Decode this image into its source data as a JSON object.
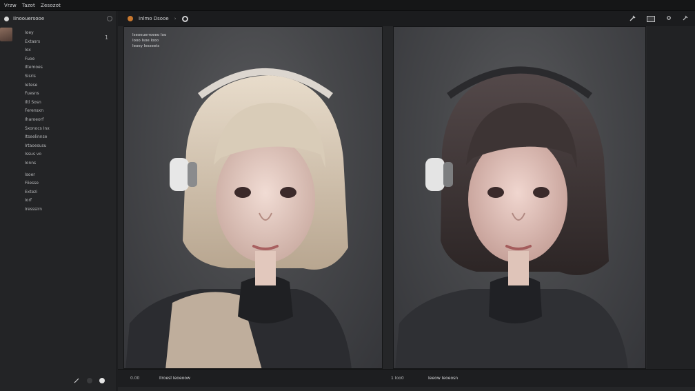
{
  "menubar": {
    "items": [
      "Vrzw",
      "Tazot",
      "Zesozot"
    ]
  },
  "sidebar": {
    "title": "Iinoouersooe",
    "count": "1",
    "items": [
      "Ioey",
      "Extasrs",
      "Iox",
      "Fuoe",
      "Iltemoes",
      "Sisris",
      "Ietese",
      "Fuesns",
      "Iltl Sosn",
      "Ferensxn",
      "Iharoeorf",
      "Sxonocs Inx",
      "Itseelinnse",
      "Irtaoesusu",
      "Issus vo",
      "Ionns",
      "Isoer",
      "Fiiesse",
      "Extezi",
      "Iorf",
      "Iresssirn"
    ]
  },
  "toolbar": {
    "title": "Inlmo Dsooe"
  },
  "panels": {
    "left": {
      "info_lines": [
        "Iseoeuerroeeo Ioo",
        "Iooo Isoe Iooo",
        "Ieoey Iesseets"
      ]
    }
  },
  "status": {
    "left_value": "0.00",
    "left_label": "Ilroesl Ieoeoow",
    "right_value": "1 Ioo0",
    "right_label": "Ieeow Ieoeosn"
  },
  "colors": {
    "background": "#1e1f21",
    "panel": "#47484b",
    "accent": "#c9782e"
  },
  "icons": [
    "settings-icon",
    "wrench-icon",
    "window-icon",
    "pin-icon",
    "globe-icon"
  ]
}
